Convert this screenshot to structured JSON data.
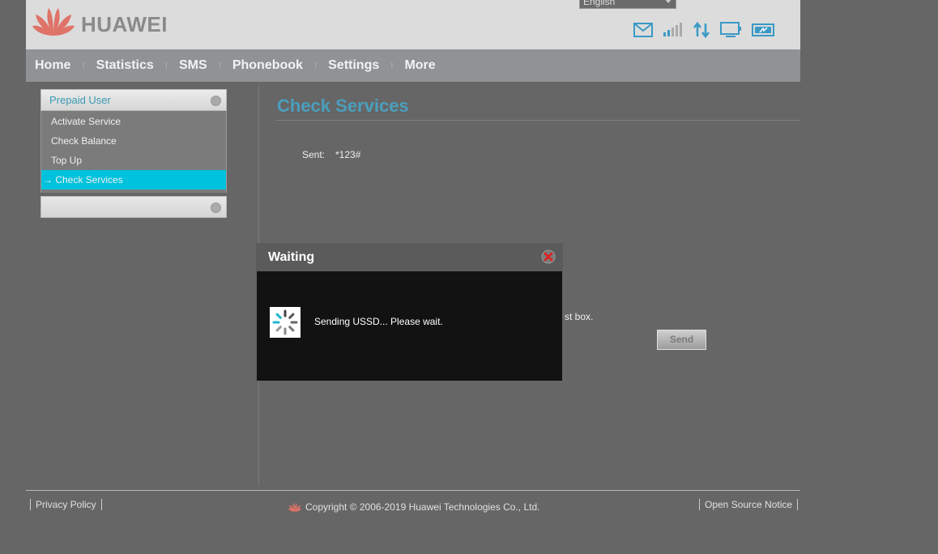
{
  "header": {
    "brand": "HUAWEI",
    "language": "English",
    "status_icons": [
      "envelope-icon",
      "signal-strength-icon",
      "data-transfer-icon",
      "monitor-icon",
      "battery-icon"
    ]
  },
  "nav": {
    "items": [
      "Home",
      "Statistics",
      "SMS",
      "Phonebook",
      "Settings",
      "More"
    ]
  },
  "sidebar": {
    "section_title": "Prepaid User",
    "items": [
      "Activate Service",
      "Check Balance",
      "Top Up",
      "→ Check Services"
    ],
    "active_index": 3
  },
  "main": {
    "title": "Check Services",
    "sent_label": "Sent:",
    "sent_value": "*123#",
    "hint_partial": "st box.",
    "send_label": "Send"
  },
  "dialog": {
    "title": "Waiting",
    "message": "Sending USSD... Please wait."
  },
  "footer": {
    "privacy": "Privacy Policy",
    "copyright": "Copyright © 2006-2019 Huawei Technologies Co., Ltd.",
    "open_source": "Open Source Notice"
  },
  "colors": {
    "accent": "#00c2dc",
    "title": "#4a9fbd",
    "logo": "#e06a5f"
  }
}
